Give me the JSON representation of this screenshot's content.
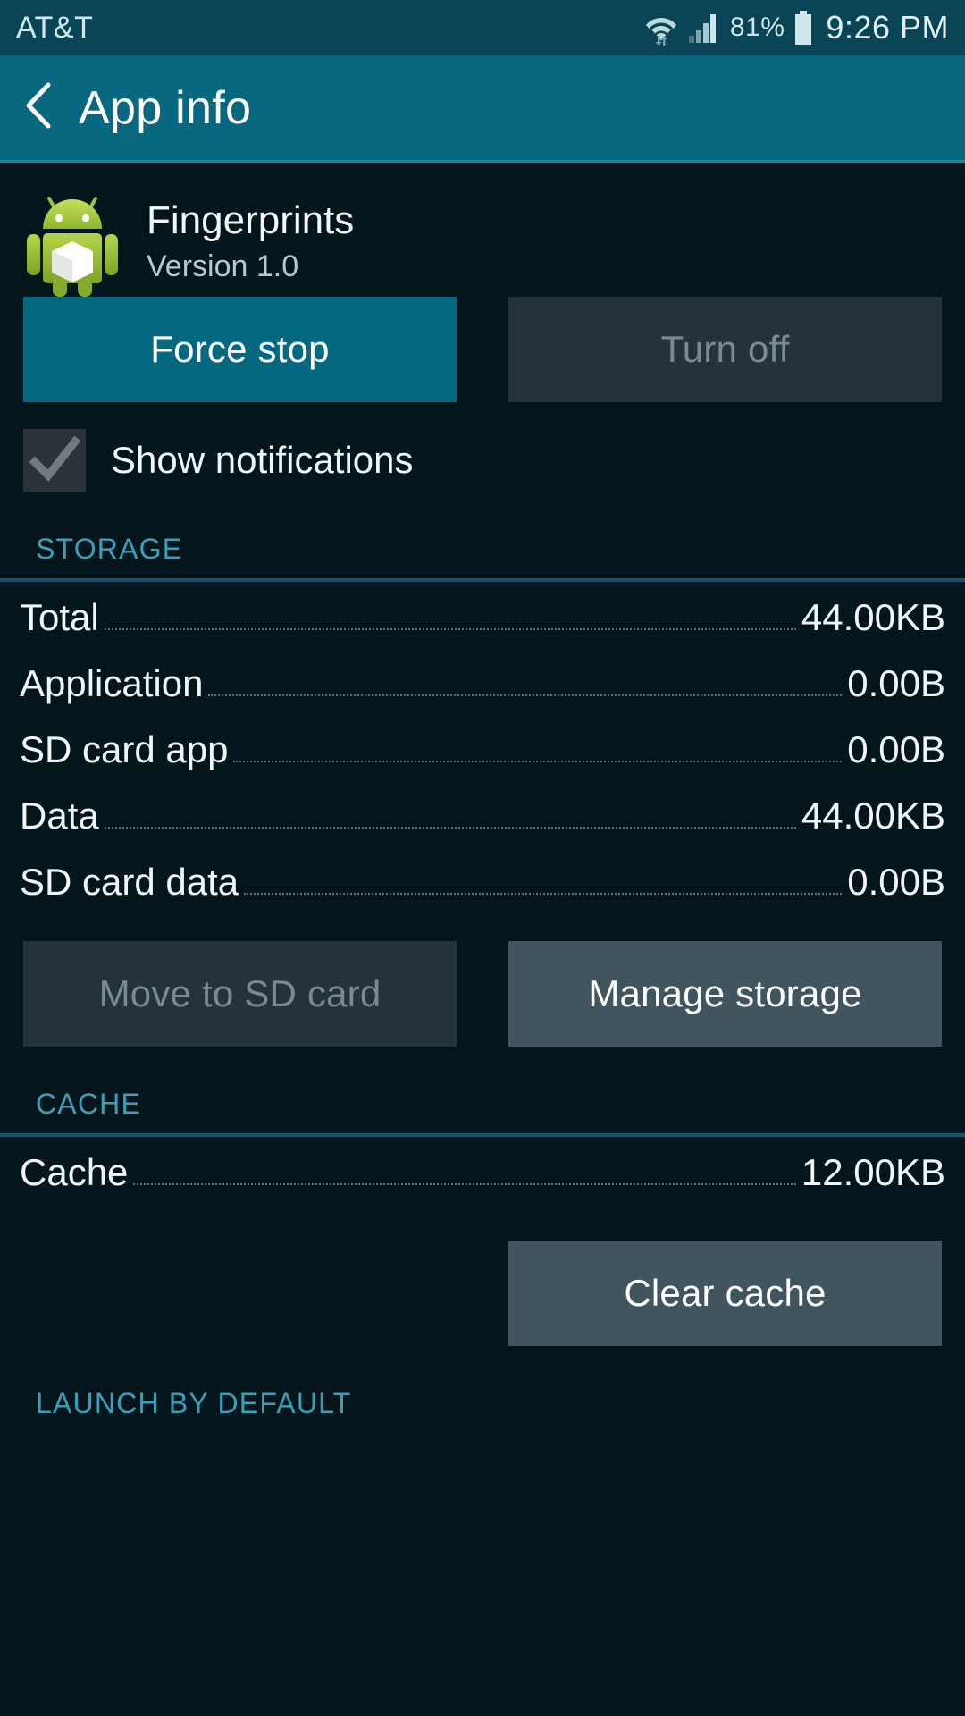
{
  "status_bar": {
    "carrier": "AT&T",
    "battery_percent": "81%",
    "clock": "9:26 PM",
    "icons": [
      "wifi-icon",
      "signal-icon",
      "battery-icon"
    ]
  },
  "action_bar": {
    "back_icon": "back-chevron-icon",
    "title": "App info"
  },
  "app": {
    "icon": "android-robot-icon",
    "name": "Fingerprints",
    "version": "Version 1.0"
  },
  "actions": {
    "force_stop_label": "Force stop",
    "turn_off_label": "Turn off"
  },
  "notifications": {
    "label": "Show notifications",
    "checked": true
  },
  "storage": {
    "section_title": "STORAGE",
    "rows": [
      {
        "label": "Total",
        "value": "44.00KB"
      },
      {
        "label": "Application",
        "value": "0.00B"
      },
      {
        "label": "SD card app",
        "value": "0.00B"
      },
      {
        "label": "Data",
        "value": "44.00KB"
      },
      {
        "label": "SD card data",
        "value": "0.00B"
      }
    ],
    "move_to_sd_label": "Move to SD card",
    "manage_storage_label": "Manage storage"
  },
  "cache": {
    "section_title": "CACHE",
    "rows": [
      {
        "label": "Cache",
        "value": "12.00KB"
      }
    ],
    "clear_cache_label": "Clear cache"
  },
  "launch_by_default": {
    "section_title": "LAUNCH BY DEFAULT"
  },
  "colors": {
    "background": "#04161c",
    "status_bar": "#0a4555",
    "action_bar": "#07687f",
    "accent_teal": "#3aa0b8",
    "primary_button": "#036880",
    "neutral_button": "#40555d",
    "disabled_button": "#26323a",
    "disabled_text": "#7a8a91",
    "divider": "#15556a",
    "robot_green": "#a4c639"
  }
}
